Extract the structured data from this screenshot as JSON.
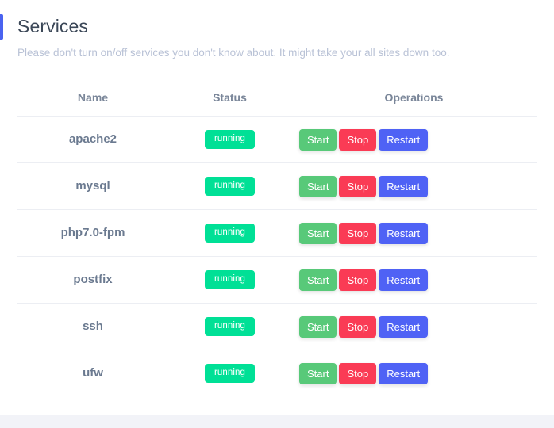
{
  "header": {
    "title": "Services",
    "subtitle": "Please don't turn on/off services you don't know about. It might take your all sites down too.",
    "accent_color": "#4a63f0"
  },
  "table": {
    "columns": [
      "Name",
      "Status",
      "Operations"
    ],
    "actions": {
      "start": "Start",
      "stop": "Stop",
      "restart": "Restart"
    },
    "action_colors": {
      "start": "#58c979",
      "stop": "#fa3b55",
      "restart": "#4f62f5"
    },
    "status_color": "#00e096",
    "rows": [
      {
        "name": "apache2",
        "status": "running"
      },
      {
        "name": "mysql",
        "status": "running"
      },
      {
        "name": "php7.0-fpm",
        "status": "running"
      },
      {
        "name": "postfix",
        "status": "running"
      },
      {
        "name": "ssh",
        "status": "running"
      },
      {
        "name": "ufw",
        "status": "running"
      }
    ]
  }
}
